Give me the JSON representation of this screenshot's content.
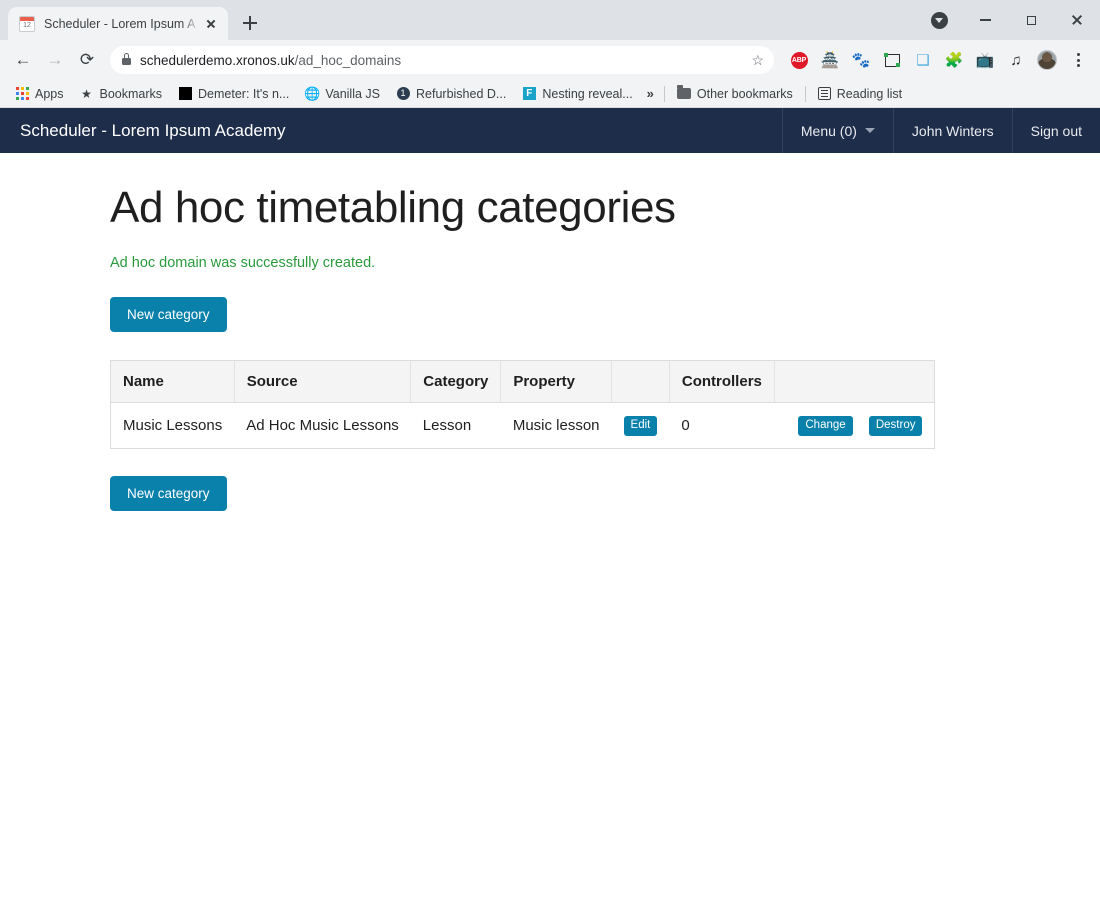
{
  "browser": {
    "tab": {
      "title": "Scheduler - Lorem Ipsum A",
      "favicon": "calendar-icon",
      "close": "×",
      "newtab": "+"
    },
    "window_controls": {
      "download": "download-icon",
      "minimize": "−",
      "maximize": "□",
      "close": "×"
    },
    "toolbar": {
      "back": "←",
      "forward": "→",
      "reload": "⟳",
      "url_domain": "schedulerdemo.xronos.uk",
      "url_path": "/ad_hoc_domains",
      "star": "☆",
      "icons": [
        {
          "name": "adblock-plus-icon",
          "label": "ABP"
        },
        {
          "name": "ghostery-icon",
          "label": "\u0001"
        },
        {
          "name": "ublock-origin-icon",
          "label": "\u0001"
        },
        {
          "name": "screenshot-icon",
          "label": ""
        },
        {
          "name": "feather-extension-icon",
          "label": ""
        },
        {
          "name": "extensions-puzzle-icon",
          "label": "\u0001"
        },
        {
          "name": "cast-icon",
          "label": "\u0001"
        },
        {
          "name": "playlist-icon",
          "label": "\u0001"
        },
        {
          "name": "profile-avatar",
          "label": ""
        },
        {
          "name": "chrome-menu-icon",
          "label": ""
        }
      ]
    },
    "bookmarks": {
      "apps": "Apps",
      "items": [
        {
          "icon": "star-icon",
          "label": "Bookmarks"
        },
        {
          "icon": "black-square-icon",
          "label": "Demeter: It's n..."
        },
        {
          "icon": "globe-icon",
          "label": "Vanilla JS"
        },
        {
          "icon": "one-badge-icon",
          "label": "Refurbished D..."
        },
        {
          "icon": "f-badge-icon",
          "label": "Nesting reveal..."
        }
      ],
      "overflow": "»",
      "other_bookmarks": "Other bookmarks",
      "reading_list": "Reading list"
    }
  },
  "app": {
    "navbar": {
      "brand": "Scheduler - Lorem Ipsum Academy",
      "menu": "Menu (0)",
      "user": "John Winters",
      "signout": "Sign out"
    },
    "heading": "Ad hoc timetabling categories",
    "flash_message": "Ad hoc domain was successfully created.",
    "new_category_top": "New category",
    "new_category_bottom": "New category",
    "table": {
      "columns": [
        "Name",
        "Source",
        "Category",
        "Property",
        "",
        "Controllers",
        ""
      ],
      "rows": [
        {
          "name": "Music Lessons",
          "source": "Ad Hoc Music Lessons",
          "category": "Lesson",
          "property": "Music lesson",
          "edit": "Edit",
          "controllers": "0",
          "change": "Change",
          "destroy": "Destroy"
        }
      ]
    },
    "colors": {
      "navbar_bg": "#1e2d4a",
      "button_blue": "#0a81ab",
      "flash_green": "#2a9a3c"
    }
  }
}
